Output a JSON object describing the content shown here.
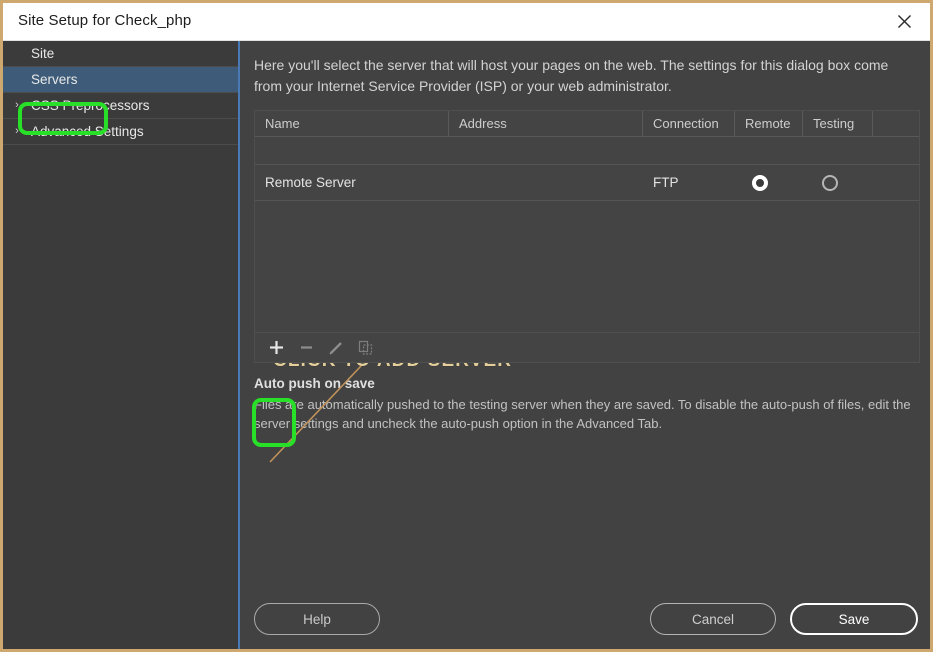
{
  "window": {
    "title": "Site Setup for Check_php",
    "close_icon": "close-icon"
  },
  "sidebar": {
    "items": [
      {
        "label": "Site",
        "expandable": false,
        "selected": false,
        "arrow": ""
      },
      {
        "label": "Servers",
        "expandable": false,
        "selected": true,
        "arrow": ""
      },
      {
        "label": "CSS Preprocessors",
        "expandable": true,
        "selected": false,
        "arrow": "›"
      },
      {
        "label": "Advanced Settings",
        "expandable": true,
        "selected": false,
        "arrow": "›"
      }
    ]
  },
  "content": {
    "intro": "Here you'll select the server that will host your pages on the web. The settings for this dialog box come from your Internet Service Provider (ISP) or your web administrator.",
    "table": {
      "columns": [
        "Name",
        "Address",
        "Connection",
        "Remote",
        "Testing"
      ],
      "rows": [
        {
          "name": "Remote Server",
          "address": "",
          "connection": "FTP",
          "remote": true,
          "testing": false
        }
      ]
    },
    "toolbar": {
      "add_label": "+",
      "remove_label": "−",
      "edit_label": "edit",
      "duplicate_label": "duplicate",
      "icons": [
        "plus-icon",
        "minus-icon",
        "pencil-icon",
        "duplicate-icon"
      ]
    },
    "autopush": {
      "title": "Auto push on save",
      "description": "Files are automatically pushed to the testing server when they are saved. To disable the auto-push of files, edit the server settings and uncheck the auto-push option in the Advanced Tab."
    }
  },
  "annotations": {
    "callout_text": "CLICK TO ADD SERVER",
    "callout_color": "#e4cf9a",
    "highlight_color": "#27e027",
    "line_color": "#c0925a"
  },
  "footer": {
    "help_label": "Help",
    "cancel_label": "Cancel",
    "save_label": "Save"
  },
  "colors": {
    "dialog_background": "#424242",
    "sidebar_background": "#3b3b3b",
    "selected_row": "#3e5c79",
    "divider_blue": "#4a7ab5",
    "frame_tan": "#cfa86f"
  }
}
